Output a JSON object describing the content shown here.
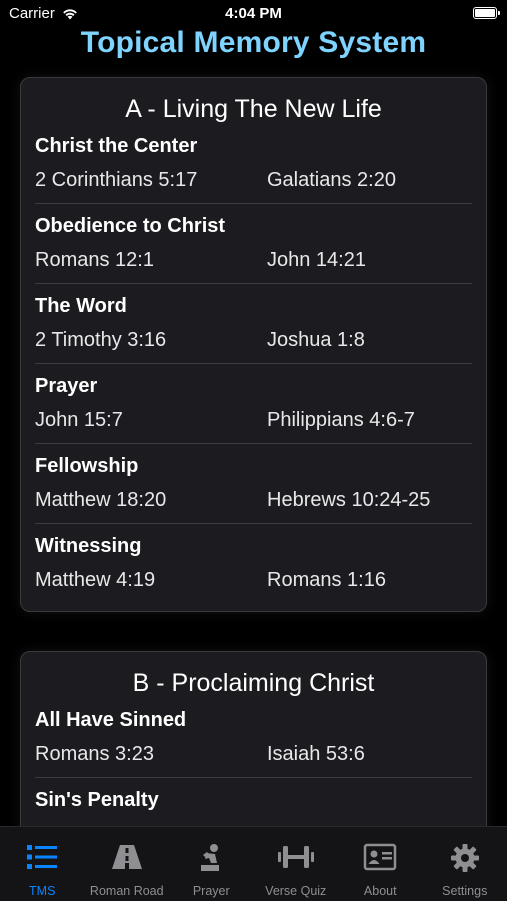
{
  "status_bar": {
    "carrier": "Carrier",
    "time": "4:04 PM"
  },
  "app_title": [
    "Topical",
    "Memory",
    "System"
  ],
  "sections": [
    {
      "title": "A - Living The New Life",
      "topics": [
        {
          "name": "Christ the Center",
          "verses": [
            "2 Corinthians 5:17",
            "Galatians 2:20"
          ]
        },
        {
          "name": "Obedience to Christ",
          "verses": [
            "Romans 12:1",
            "John 14:21"
          ]
        },
        {
          "name": "The Word",
          "verses": [
            "2 Timothy 3:16",
            "Joshua 1:8"
          ]
        },
        {
          "name": "Prayer",
          "verses": [
            "John 15:7",
            "Philippians 4:6-7"
          ]
        },
        {
          "name": "Fellowship",
          "verses": [
            "Matthew 18:20",
            "Hebrews 10:24-25"
          ]
        },
        {
          "name": "Witnessing",
          "verses": [
            "Matthew 4:19",
            "Romans 1:16"
          ]
        }
      ]
    },
    {
      "title": "B - Proclaiming Christ",
      "topics": [
        {
          "name": "All Have Sinned",
          "verses": [
            "Romans 3:23",
            "Isaiah 53:6"
          ]
        },
        {
          "name": "Sin's Penalty",
          "verses": [
            "",
            ""
          ]
        }
      ]
    }
  ],
  "tab_bar": {
    "tabs": [
      {
        "label": "TMS",
        "icon": "list-icon",
        "active": true
      },
      {
        "label": "Roman Road",
        "icon": "road-icon",
        "active": false
      },
      {
        "label": "Prayer",
        "icon": "praying-person-icon",
        "active": false
      },
      {
        "label": "Verse Quiz",
        "icon": "dumbbell-icon",
        "active": false
      },
      {
        "label": "About",
        "icon": "id-card-icon",
        "active": false
      },
      {
        "label": "Settings",
        "icon": "gear-icon",
        "active": false
      }
    ],
    "active_color": "#0a84ff",
    "inactive_color": "#8e8e93"
  },
  "title_color": "#7fd3ff"
}
